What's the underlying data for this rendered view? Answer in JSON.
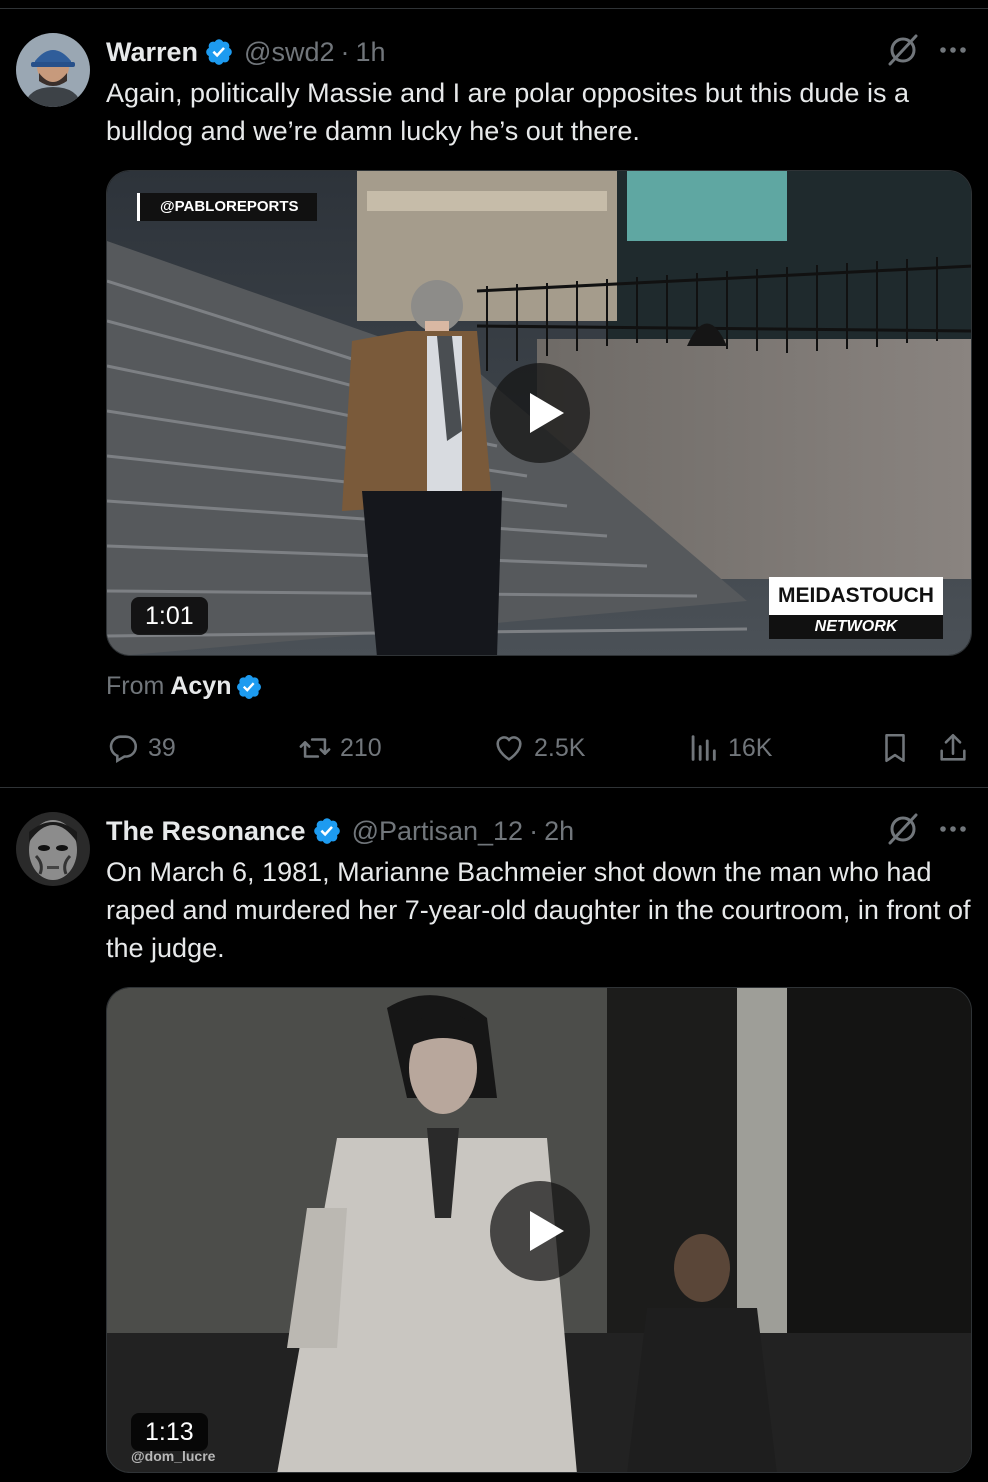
{
  "colors": {
    "background": "#000000",
    "text": "#e7e9ea",
    "secondary": "#71767b",
    "verified": "#1d9bf0",
    "divider": "#2f3336"
  },
  "tweets": [
    {
      "name": "Warren",
      "handle": "@swd2",
      "dot": "·",
      "time": "1h",
      "text": "Again, politically Massie and I are polar opposites but this dude is a bulldog and we’re damn lucky he’s out there.",
      "media": {
        "type": "video",
        "duration": "1:01",
        "overlay_tag": "@PABLOREPORTS",
        "brand_top": "MEIDASTOUCH",
        "brand_bottom": "NETWORK"
      },
      "from_label": "From",
      "from_name": "Acyn",
      "stats": {
        "replies": "39",
        "reposts": "210",
        "likes": "2.5K",
        "views": "16K"
      }
    },
    {
      "name": "The Resonance",
      "handle": "@Partisan_12",
      "dot": "·",
      "time": "2h",
      "text": "On March 6, 1981, Marianne Bachmeier shot down the man who had raped and murdered her 7-year-old daughter in the courtroom, in front of the judge.",
      "media": {
        "type": "video",
        "duration": "1:13",
        "watermark": "@dom_lucre"
      }
    }
  ],
  "icons": [
    "verified-badge-icon",
    "grok-icon",
    "more-icon",
    "play-icon",
    "reply-icon",
    "repost-icon",
    "like-icon",
    "views-icon",
    "bookmark-icon",
    "share-icon"
  ]
}
